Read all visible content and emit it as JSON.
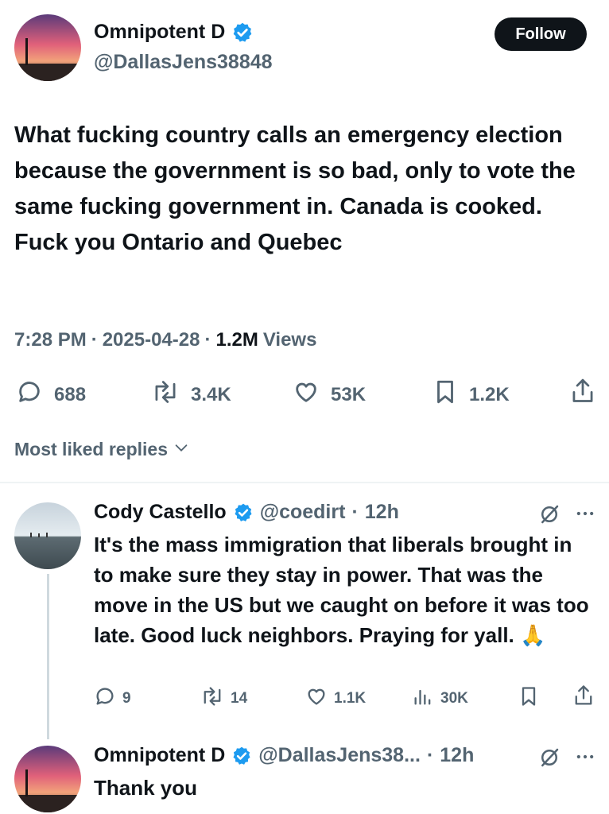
{
  "tweet": {
    "author_name": "Omnipotent D",
    "author_handle": "@DallasJens38848",
    "follow_label": "Follow",
    "text": "What fucking country calls an emergency election because the government is so bad, only to vote the same fucking government in. Canada is cooked.  Fuck you Ontario and Quebec",
    "time": "7:28 PM",
    "date": "2025-04-28",
    "views_count": "1.2M",
    "views_label": "Views",
    "sep": "·",
    "stats": {
      "replies": "688",
      "reposts": "3.4K",
      "likes": "53K",
      "bookmarks": "1.2K"
    }
  },
  "replies_filter": {
    "label": "Most liked replies"
  },
  "replies": [
    {
      "author_name": "Cody Castello",
      "author_handle": "@coedirt",
      "age": "12h",
      "text": "It's the mass immigration that liberals brought in to make sure they stay in power. That was the move in the US but we caught on before it was too late. Good luck neighbors. Praying for yall. 🙏",
      "stats": {
        "replies": "9",
        "reposts": "14",
        "likes": "1.1K",
        "views": "30K"
      }
    },
    {
      "author_name": "Omnipotent D",
      "author_handle": "@DallasJens38...",
      "age": "12h",
      "text": "Thank you"
    }
  ],
  "colors": {
    "text": "#0f1419",
    "muted": "#536471",
    "verified": "#1d9bf0",
    "divider": "#eff3f4"
  },
  "icons": [
    "verified-badge-icon",
    "reply-icon",
    "repost-icon",
    "like-icon",
    "bookmark-icon",
    "share-icon",
    "views-icon",
    "grok-icon",
    "more-icon",
    "chevron-down-icon"
  ]
}
